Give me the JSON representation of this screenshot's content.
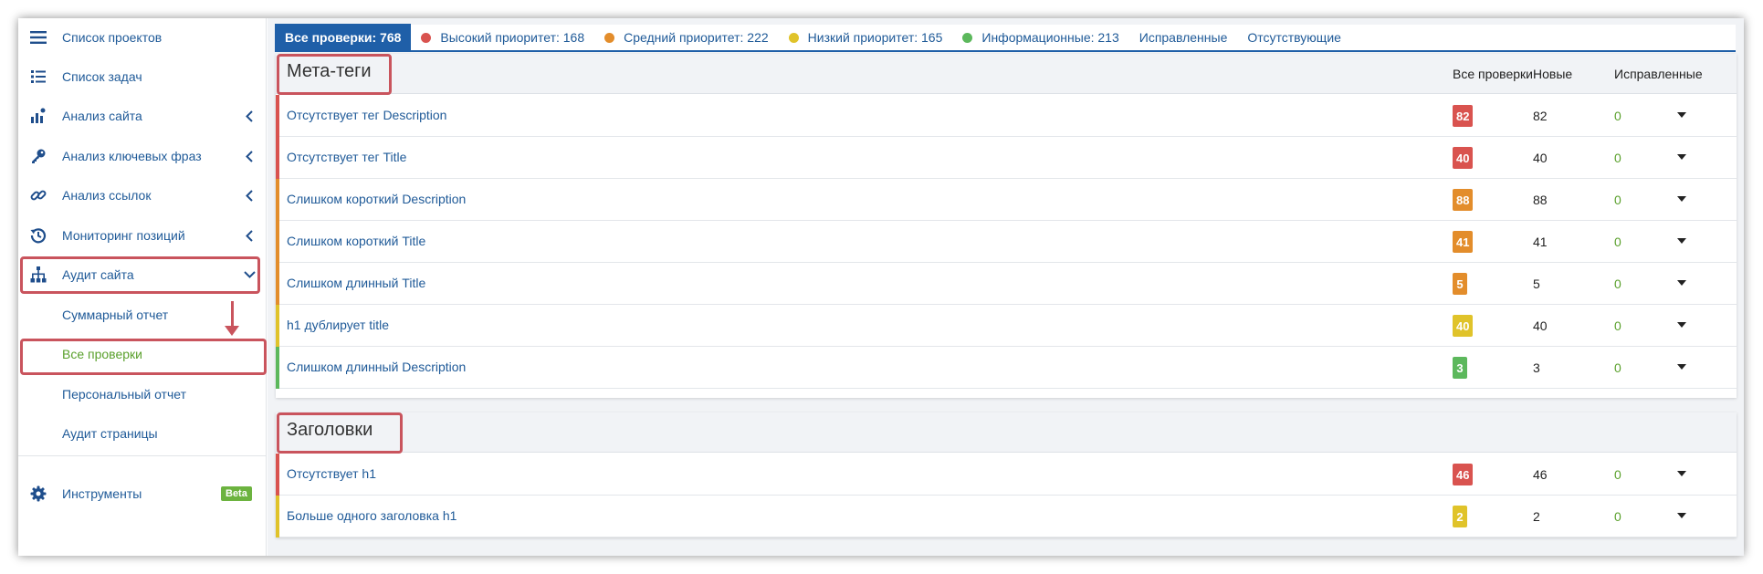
{
  "sidebar": {
    "items": [
      {
        "label": "Список проектов",
        "icon": "menu-icon"
      },
      {
        "label": "Список задач",
        "icon": "list-icon"
      },
      {
        "label": "Анализ сайта",
        "icon": "analytics-icon"
      },
      {
        "label": "Анализ ключевых фраз",
        "icon": "key-icon"
      },
      {
        "label": "Анализ ссылок",
        "icon": "link-icon"
      },
      {
        "label": "Мониторинг позиций",
        "icon": "history-icon"
      },
      {
        "label": "Аудит сайта",
        "icon": "sitemap-icon"
      }
    ],
    "sub_items": [
      {
        "label": "Суммарный отчет"
      },
      {
        "label": "Все проверки"
      },
      {
        "label": "Персональный отчет"
      },
      {
        "label": "Аудит страницы"
      }
    ],
    "tools": {
      "label": "Инструменты",
      "icon": "gear-icon",
      "badge": "Beta"
    }
  },
  "tabs": [
    {
      "label": "Все проверки: 768"
    },
    {
      "label": "Высокий приоритет: 168",
      "dot": "#d9534f"
    },
    {
      "label": "Средний приоритет: 222",
      "dot": "#e38d2b"
    },
    {
      "label": "Низкий приоритет: 165",
      "dot": "#e0c32a"
    },
    {
      "label": "Информационные: 213",
      "dot": "#5cb85c"
    },
    {
      "label": "Исправленные"
    },
    {
      "label": "Отсутствующие"
    }
  ],
  "columns": {
    "all": "Все проверки",
    "new": "Новые",
    "fixed": "Исправленные"
  },
  "sections": [
    {
      "title": "Мета-теги",
      "rows": [
        {
          "label": "Отсутствует тег Description",
          "all": "82",
          "new": "82",
          "fixed": "0",
          "color": "#d9534f"
        },
        {
          "label": "Отсутствует тег Title",
          "all": "40",
          "new": "40",
          "fixed": "0",
          "color": "#d9534f"
        },
        {
          "label": "Слишком короткий Description",
          "all": "88",
          "new": "88",
          "fixed": "0",
          "color": "#e38d2b"
        },
        {
          "label": "Слишком короткий Title",
          "all": "41",
          "new": "41",
          "fixed": "0",
          "color": "#e38d2b"
        },
        {
          "label": "Слишком длинный Title",
          "all": "5",
          "new": "5",
          "fixed": "0",
          "color": "#e38d2b"
        },
        {
          "label": "h1 дублирует title",
          "all": "40",
          "new": "40",
          "fixed": "0",
          "color": "#e0c32a"
        },
        {
          "label": "Слишком длинный Description",
          "all": "3",
          "new": "3",
          "fixed": "0",
          "color": "#5cb85c"
        }
      ]
    },
    {
      "title": "Заголовки",
      "rows": [
        {
          "label": "Отсутствует h1",
          "all": "46",
          "new": "46",
          "fixed": "0",
          "color": "#d9534f"
        },
        {
          "label": "Больше одного заголовка h1",
          "all": "2",
          "new": "2",
          "fixed": "0",
          "color": "#e0c32a"
        }
      ]
    }
  ]
}
